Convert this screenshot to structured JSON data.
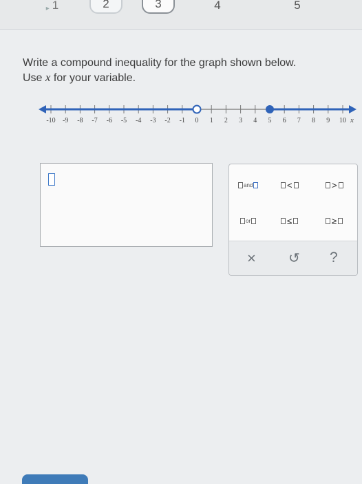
{
  "steps": [
    "1",
    "2",
    "3",
    "4",
    "5"
  ],
  "prompt": {
    "line1": "Write a compound inequality for the graph shown below.",
    "line2_before": "Use ",
    "line2_var": "x",
    "line2_after": " for your variable."
  },
  "number_line": {
    "tick_labels": [
      "-10",
      "-9",
      "-8",
      "-7",
      "-6",
      "-5",
      "-4",
      "-3",
      "-2",
      "-1",
      "0",
      "1",
      "2",
      "3",
      "4",
      "5",
      "6",
      "7",
      "8",
      "9",
      "10"
    ],
    "axis_var": "x",
    "open_point": 0,
    "closed_point": 5,
    "shade_left_from": 0,
    "shade_right_from": 5
  },
  "palette": {
    "and_label": "and",
    "or_label": "or",
    "lt": "<",
    "gt": ">",
    "le": "≤",
    "ge": "≥",
    "clear_icon": "×",
    "undo_icon": "↺",
    "help_icon": "?"
  },
  "colors": {
    "accent": "#3c6fc1",
    "line_blue": "#2f63b8"
  }
}
